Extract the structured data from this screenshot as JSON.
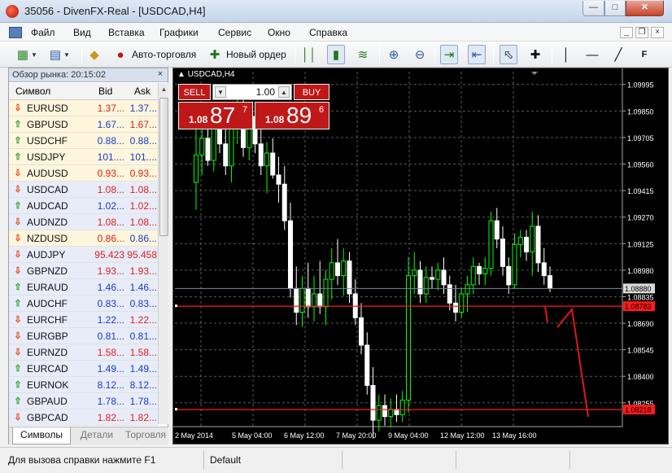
{
  "window": {
    "title": "35056 - DivenFX-Real - [USDCAD,H4]"
  },
  "menu": {
    "items": [
      "Файл",
      "Вид",
      "Вставка",
      "Графики",
      "Сервис",
      "Окно",
      "Справка"
    ]
  },
  "toolbar": {
    "auto_trading_label": "Авто-торговля",
    "new_order_label": "Новый ордер"
  },
  "market_watch": {
    "title": "Обзор рынка: 20:15:02",
    "columns": {
      "symbol": "Символ",
      "bid": "Bid",
      "ask": "Ask"
    },
    "rows": [
      {
        "symbol": "EURUSD",
        "dir": "down",
        "bid": "1.37...",
        "ask": "1.37...",
        "bid_color": "#e02020",
        "ask_color": "#1a3ad0",
        "bg": "#fdf6dc"
      },
      {
        "symbol": "GBPUSD",
        "dir": "up",
        "bid": "1.67...",
        "ask": "1.67...",
        "bid_color": "#1a3ad0",
        "ask_color": "#e02020",
        "bg": "#fdf6dc"
      },
      {
        "symbol": "USDCHF",
        "dir": "up",
        "bid": "0.88...",
        "ask": "0.88...",
        "bid_color": "#1a3ad0",
        "ask_color": "#1a3ad0",
        "bg": "#fdf6dc"
      },
      {
        "symbol": "USDJPY",
        "dir": "up",
        "bid": "101....",
        "ask": "101....",
        "bid_color": "#1a3ad0",
        "ask_color": "#1a3ad0",
        "bg": "#fdf6dc"
      },
      {
        "symbol": "AUDUSD",
        "dir": "down",
        "bid": "0.93...",
        "ask": "0.93...",
        "bid_color": "#e02020",
        "ask_color": "#e02020",
        "bg": "#fdf6dc"
      },
      {
        "symbol": "USDCAD",
        "dir": "down",
        "bid": "1.08...",
        "ask": "1.08...",
        "bid_color": "#e02020",
        "ask_color": "#e02020",
        "bg": "#e7ecf8"
      },
      {
        "symbol": "AUDCAD",
        "dir": "up",
        "bid": "1.02...",
        "ask": "1.02...",
        "bid_color": "#1a3ad0",
        "ask_color": "#e02020",
        "bg": "#e7ecf8"
      },
      {
        "symbol": "AUDNZD",
        "dir": "down",
        "bid": "1.08...",
        "ask": "1.08...",
        "bid_color": "#e02020",
        "ask_color": "#e02020",
        "bg": "#e7ecf8"
      },
      {
        "symbol": "NZDUSD",
        "dir": "down",
        "bid": "0.86...",
        "ask": "0.86...",
        "bid_color": "#e02020",
        "ask_color": "#1a3ad0",
        "bg": "#fdf6dc"
      },
      {
        "symbol": "AUDJPY",
        "dir": "down",
        "bid": "95.423",
        "ask": "95.458",
        "bid_color": "#e02020",
        "ask_color": "#e02020",
        "bg": "#e7ecf8"
      },
      {
        "symbol": "GBPNZD",
        "dir": "down",
        "bid": "1.93...",
        "ask": "1.93...",
        "bid_color": "#e02020",
        "ask_color": "#e02020",
        "bg": "#e7ecf8"
      },
      {
        "symbol": "EURAUD",
        "dir": "up",
        "bid": "1.46...",
        "ask": "1.46...",
        "bid_color": "#1a3ad0",
        "ask_color": "#1a3ad0",
        "bg": "#e7ecf8"
      },
      {
        "symbol": "AUDCHF",
        "dir": "up",
        "bid": "0.83...",
        "ask": "0.83...",
        "bid_color": "#1a3ad0",
        "ask_color": "#1a3ad0",
        "bg": "#e7ecf8"
      },
      {
        "symbol": "EURCHF",
        "dir": "down",
        "bid": "1.22...",
        "ask": "1.22...",
        "bid_color": "#1a3ad0",
        "ask_color": "#e02020",
        "bg": "#e7ecf8"
      },
      {
        "symbol": "EURGBP",
        "dir": "down",
        "bid": "0.81...",
        "ask": "0.81...",
        "bid_color": "#1a3ad0",
        "ask_color": "#1a3ad0",
        "bg": "#e7ecf8"
      },
      {
        "symbol": "EURNZD",
        "dir": "down",
        "bid": "1.58...",
        "ask": "1.58...",
        "bid_color": "#e02020",
        "ask_color": "#e02020",
        "bg": "#e7ecf8"
      },
      {
        "symbol": "EURCAD",
        "dir": "up",
        "bid": "1.49...",
        "ask": "1.49...",
        "bid_color": "#1a3ad0",
        "ask_color": "#1a3ad0",
        "bg": "#e7ecf8"
      },
      {
        "symbol": "EURNOK",
        "dir": "up",
        "bid": "8.12...",
        "ask": "8.12...",
        "bid_color": "#1a3ad0",
        "ask_color": "#1a3ad0",
        "bg": "#e7ecf8"
      },
      {
        "symbol": "GBPAUD",
        "dir": "up",
        "bid": "1.78...",
        "ask": "1.78...",
        "bid_color": "#1a3ad0",
        "ask_color": "#1a3ad0",
        "bg": "#e7ecf8"
      },
      {
        "symbol": "GBPCAD",
        "dir": "down",
        "bid": "1.82...",
        "ask": "1.82...",
        "bid_color": "#e02020",
        "ask_color": "#e02020",
        "bg": "#e7ecf8"
      }
    ],
    "tabs": [
      "Символы",
      "Детали",
      "Торговля"
    ]
  },
  "trading": {
    "sell_label": "SELL",
    "buy_label": "BUY",
    "lot": "1.00",
    "sell_prefix": "1.08",
    "sell_big": "87",
    "sell_sup": "7",
    "buy_prefix": "1.08",
    "buy_big": "89",
    "buy_sup": "6"
  },
  "chart_data": {
    "type": "candlestick",
    "symbol_label": "USDCAD,H4",
    "ylim": [
      1.08125,
      1.10065
    ],
    "y_ticks": [
      "1.09995",
      "1.09850",
      "1.09705",
      "1.09560",
      "1.09415",
      "1.09270",
      "1.09125",
      "1.08980",
      "1.08835",
      "1.08690",
      "1.08545",
      "1.08400",
      "1.08255"
    ],
    "x_ticks": [
      "2 May 2014",
      "5 May 04:00",
      "6 May 12:00",
      "7 May 20:00",
      "9 May 04:00",
      "12 May 12:00",
      "13 May 16:00"
    ],
    "current_price": "1.08880",
    "level_high": "1.08783",
    "level_low": "1.08218",
    "colors": {
      "up": "#00ff00",
      "down": "#ffffff",
      "grid": "#5a5a5a",
      "level": "#ff1a1a",
      "bg": "#000000"
    },
    "candles": [
      [
        1.0946,
        1.0977,
        1.0931,
        1.0961
      ],
      [
        1.0961,
        1.098,
        1.095,
        1.097
      ],
      [
        1.097,
        1.0982,
        1.0955,
        1.0958
      ],
      [
        1.0958,
        1.0982,
        1.0952,
        1.0978
      ],
      [
        1.0978,
        1.099,
        1.0962,
        1.0967
      ],
      [
        1.0967,
        1.0985,
        1.095,
        1.0955
      ],
      [
        1.0955,
        1.0985,
        1.0946,
        1.0978
      ],
      [
        1.0978,
        1.0998,
        1.0967,
        1.0988
      ],
      [
        1.0988,
        1.0993,
        1.096,
        1.0965
      ],
      [
        1.0965,
        1.099,
        1.0958,
        1.0982
      ],
      [
        1.0982,
        1.0988,
        1.0962,
        1.0967
      ],
      [
        1.0967,
        1.0976,
        1.095,
        1.0955
      ],
      [
        1.0955,
        1.0968,
        1.094,
        1.0962
      ],
      [
        1.0962,
        1.097,
        1.0948,
        1.095
      ],
      [
        1.095,
        1.096,
        1.0935,
        1.0945
      ],
      [
        1.0945,
        1.0955,
        1.092,
        1.0925
      ],
      [
        1.0925,
        1.0935,
        1.0883,
        1.0888
      ],
      [
        1.0888,
        1.09,
        1.0868,
        1.0875
      ],
      [
        1.0875,
        1.0895,
        1.0867,
        1.0888
      ],
      [
        1.0888,
        1.0902,
        1.0872,
        1.0878
      ],
      [
        1.0878,
        1.0895,
        1.087,
        1.0885
      ],
      [
        1.0885,
        1.0903,
        1.0874,
        1.0878
      ],
      [
        1.0878,
        1.0898,
        1.0868,
        1.0893
      ],
      [
        1.0893,
        1.091,
        1.0882,
        1.0902
      ],
      [
        1.0902,
        1.0915,
        1.089,
        1.0895
      ],
      [
        1.0895,
        1.091,
        1.0884,
        1.0903
      ],
      [
        1.0903,
        1.0908,
        1.088,
        1.0885
      ],
      [
        1.0885,
        1.0893,
        1.0868,
        1.0872
      ],
      [
        1.0872,
        1.088,
        1.0852,
        1.0857
      ],
      [
        1.0857,
        1.0864,
        1.083,
        1.0835
      ],
      [
        1.0835,
        1.0845,
        1.0806,
        1.0816
      ],
      [
        1.0816,
        1.083,
        1.081,
        1.0824
      ],
      [
        1.0824,
        1.083,
        1.0813,
        1.0818
      ],
      [
        1.0818,
        1.0828,
        1.0812,
        1.0822
      ],
      [
        1.0822,
        1.083,
        1.0815,
        1.0819
      ],
      [
        1.0819,
        1.0832,
        1.0815,
        1.0827
      ],
      [
        1.0827,
        1.0905,
        1.082,
        1.0895
      ],
      [
        1.0895,
        1.0908,
        1.0885,
        1.0898
      ],
      [
        1.0898,
        1.0903,
        1.088,
        1.0885
      ],
      [
        1.0885,
        1.09,
        1.088,
        1.0894
      ],
      [
        1.0894,
        1.09,
        1.0888,
        1.0893
      ],
      [
        1.0893,
        1.0902,
        1.0887,
        1.0898
      ],
      [
        1.0898,
        1.0905,
        1.0885,
        1.089
      ],
      [
        1.089,
        1.0895,
        1.0876,
        1.088
      ],
      [
        1.088,
        1.089,
        1.087,
        1.0875
      ],
      [
        1.0875,
        1.0888,
        1.0872,
        1.0885
      ],
      [
        1.0885,
        1.0895,
        1.0875,
        1.089
      ],
      [
        1.089,
        1.0905,
        1.0885,
        1.09
      ],
      [
        1.09,
        1.0902,
        1.089,
        1.0896
      ],
      [
        1.0896,
        1.0905,
        1.089,
        1.0899
      ],
      [
        1.0899,
        1.093,
        1.0895,
        1.0925
      ],
      [
        1.0925,
        1.0932,
        1.091,
        1.0915
      ],
      [
        1.0915,
        1.0922,
        1.0895,
        1.09
      ],
      [
        1.09,
        1.0905,
        1.0885,
        1.089
      ],
      [
        1.089,
        1.0918,
        1.0888,
        1.0912
      ],
      [
        1.0912,
        1.092,
        1.0905,
        1.0916
      ],
      [
        1.0916,
        1.092,
        1.0903,
        1.0908
      ],
      [
        1.0908,
        1.093,
        1.0895,
        1.0922
      ],
      [
        1.0922,
        1.0928,
        1.0897,
        1.0902
      ],
      [
        1.0902,
        1.091,
        1.089,
        1.0895
      ],
      [
        1.0895,
        1.09,
        1.0886,
        1.0888
      ]
    ]
  },
  "status": {
    "help_text": "Для вызова справки нажмите F1",
    "profile": "Default"
  }
}
